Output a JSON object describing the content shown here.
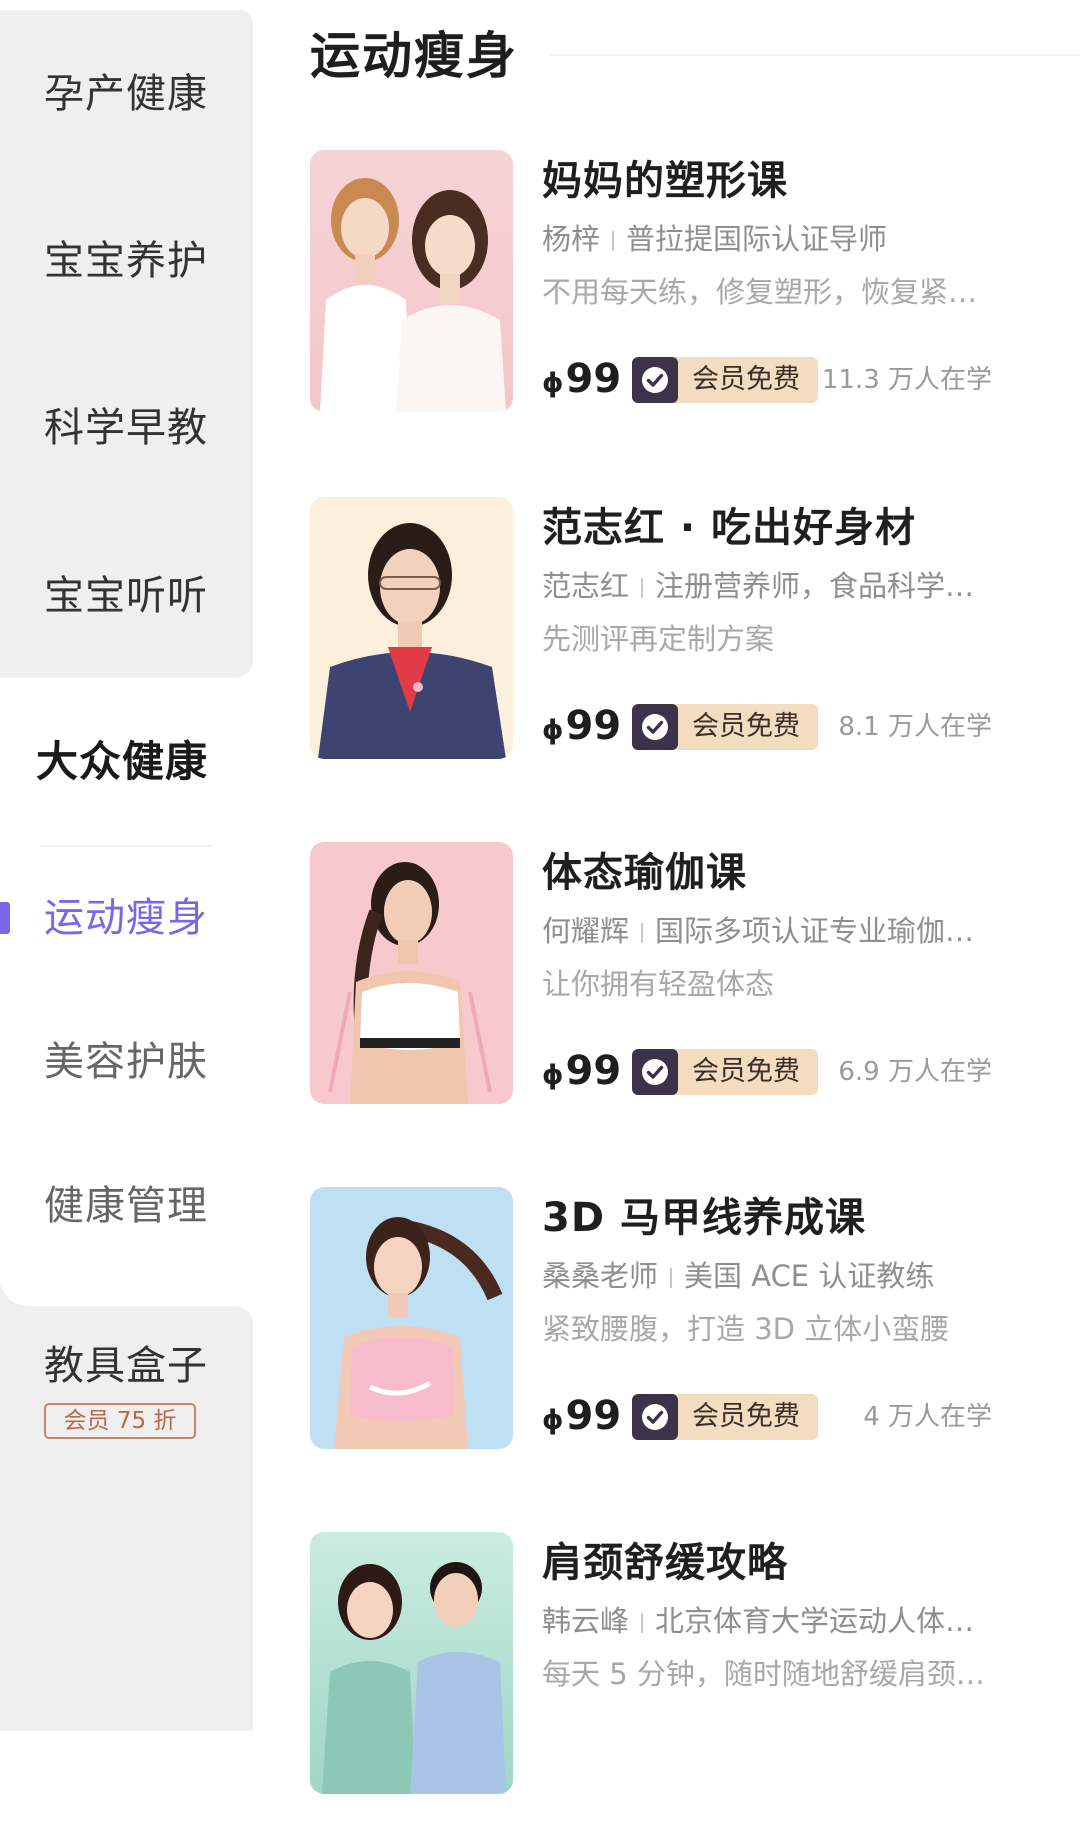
{
  "sidebar": {
    "items": [
      {
        "label": "孕产健康"
      },
      {
        "label": "宝宝养护"
      },
      {
        "label": "科学早教"
      },
      {
        "label": "宝宝听听"
      },
      {
        "label": "大众健康"
      },
      {
        "label": "运动瘦身"
      },
      {
        "label": "美容护肤"
      },
      {
        "label": "健康管理"
      },
      {
        "label": "教具盒子",
        "badge": "会员 75 折"
      }
    ]
  },
  "main": {
    "title": "运动瘦身",
    "courses": [
      {
        "title": "妈妈的塑形课",
        "teacher": "杨梓",
        "credential": "普拉提国际认证导师",
        "desc": "不用每天练，修复塑形，恢复紧…",
        "currency": "ɸ",
        "price": "99",
        "vip_label": "会员免费",
        "learners": "11.3 万人在学"
      },
      {
        "title": "范志红 · 吃出好身材",
        "teacher": "范志红",
        "credential": "注册营养师，食品科学…",
        "desc": "先测评再定制方案",
        "currency": "ɸ",
        "price": "99",
        "vip_label": "会员免费",
        "learners": "8.1 万人在学"
      },
      {
        "title": "体态瑜伽课",
        "teacher": "何耀辉",
        "credential": "国际多项认证专业瑜伽…",
        "desc": "让你拥有轻盈体态",
        "currency": "ɸ",
        "price": "99",
        "vip_label": "会员免费",
        "learners": "6.9 万人在学"
      },
      {
        "title": "3D 马甲线养成课",
        "teacher": "桑桑老师",
        "credential": "美国 ACE 认证教练",
        "desc": "紧致腰腹，打造 3D 立体小蛮腰",
        "currency": "ɸ",
        "price": "99",
        "vip_label": "会员免费",
        "learners": "4 万人在学"
      },
      {
        "title": "肩颈舒缓攻略",
        "teacher": "韩云峰",
        "credential": "北京体育大学运动人体…",
        "desc": "每天 5 分钟，随时随地舒缓肩颈…"
      }
    ]
  },
  "colors": {
    "accent": "#7a67e8",
    "sidebar_bg": "#efefef",
    "vip_bg": "#f3dcc0",
    "vip_icon_bg": "#3b334a",
    "badge_border": "#c6866b"
  }
}
